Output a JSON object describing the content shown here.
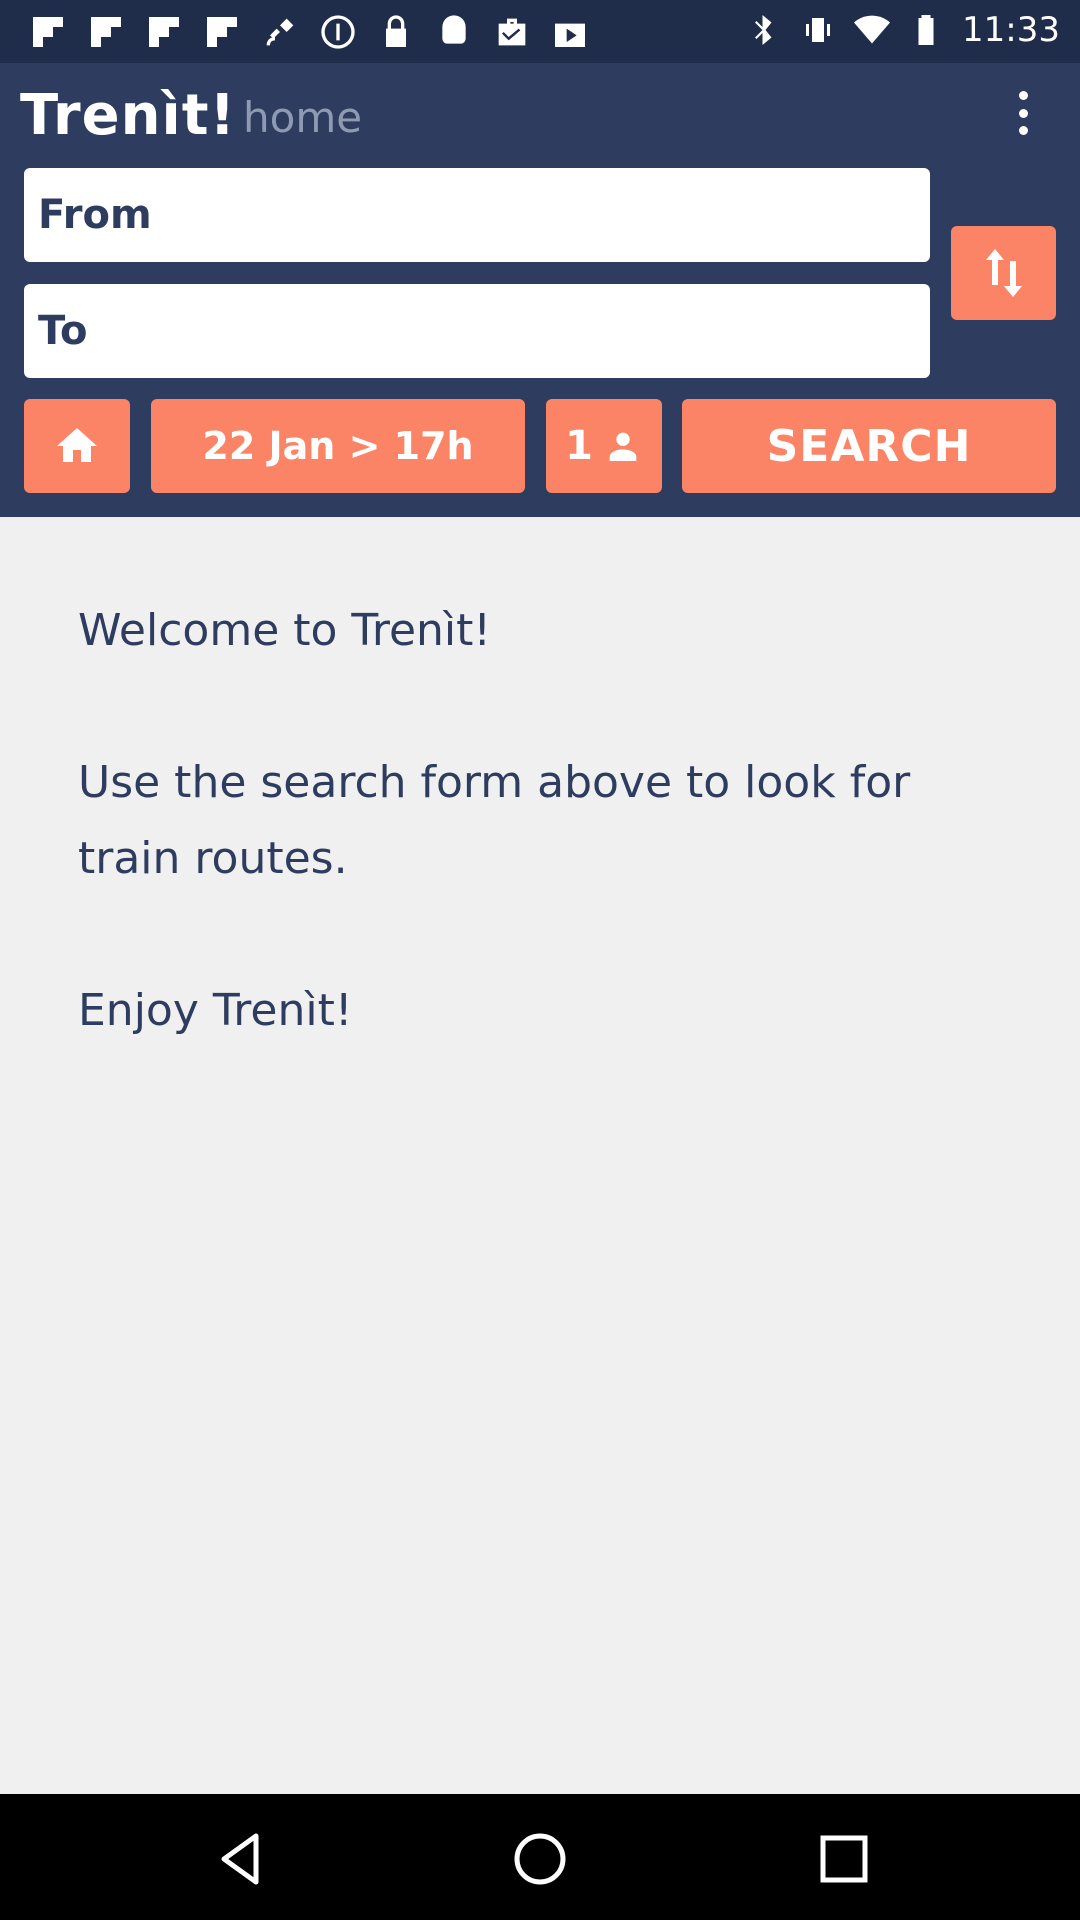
{
  "status_bar": {
    "time": "11:33",
    "left_icons": [
      "flipboard-icon",
      "flipboard-icon",
      "flipboard-icon",
      "flipboard-icon",
      "fake-gps-icon",
      "blocked-icon",
      "lock-icon",
      "android-icon",
      "briefcase-check-icon",
      "play-store-icon"
    ],
    "right_icons": [
      "bluetooth-icon",
      "vibrate-icon",
      "wifi-icon",
      "battery-icon"
    ]
  },
  "header": {
    "logo": "Trenìt!",
    "page": "home"
  },
  "search_form": {
    "from_placeholder": "From",
    "to_placeholder": "To",
    "date_label": "22 Jan > 17h",
    "passengers_count": "1",
    "search_label": "SEARCH"
  },
  "welcome": {
    "line1": "Welcome to Trenìt!",
    "line2": "Use the search form above to look for train routes.",
    "line3": "Enjoy Trenìt!"
  },
  "colors": {
    "header_bg": "#2e3d5f",
    "accent": "#fb8466",
    "body_bg": "#f0f0f0"
  }
}
